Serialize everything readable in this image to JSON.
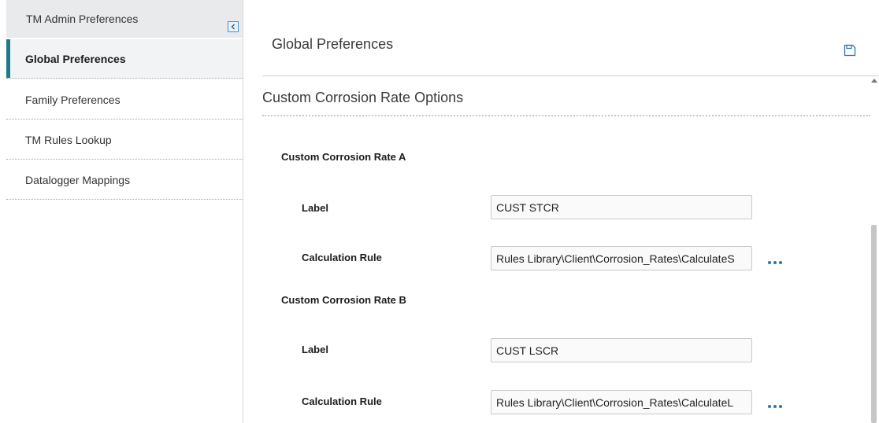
{
  "sidebar": {
    "header_title": "TM Admin Preferences",
    "items": [
      {
        "label": "Global Preferences",
        "active": true
      },
      {
        "label": "Family Preferences",
        "active": false
      },
      {
        "label": "TM Rules Lookup",
        "active": false
      },
      {
        "label": "Datalogger Mappings",
        "active": false
      }
    ]
  },
  "main": {
    "page_title": "Global Preferences",
    "section_title": "Custom Corrosion Rate Options",
    "groups": [
      {
        "title": "Custom Corrosion Rate A",
        "label_caption": "Label",
        "label_value": "CUST STCR",
        "rule_caption": "Calculation Rule",
        "rule_value": "Rules Library\\Client\\Corrosion_Rates\\CalculateS"
      },
      {
        "title": "Custom Corrosion Rate B",
        "label_caption": "Label",
        "label_value": "CUST LSCR",
        "rule_caption": "Calculation Rule",
        "rule_value": "Rules Library\\Client\\Corrosion_Rates\\CalculateL"
      }
    ]
  },
  "icons": {
    "collapse": "chevron-left-icon",
    "save": "save-icon",
    "browse": "ellipsis-icon"
  },
  "colors": {
    "accent": "#1f7a8c",
    "link_blue": "#2b72b6",
    "sidebar_header_bg": "#e9eaec"
  }
}
